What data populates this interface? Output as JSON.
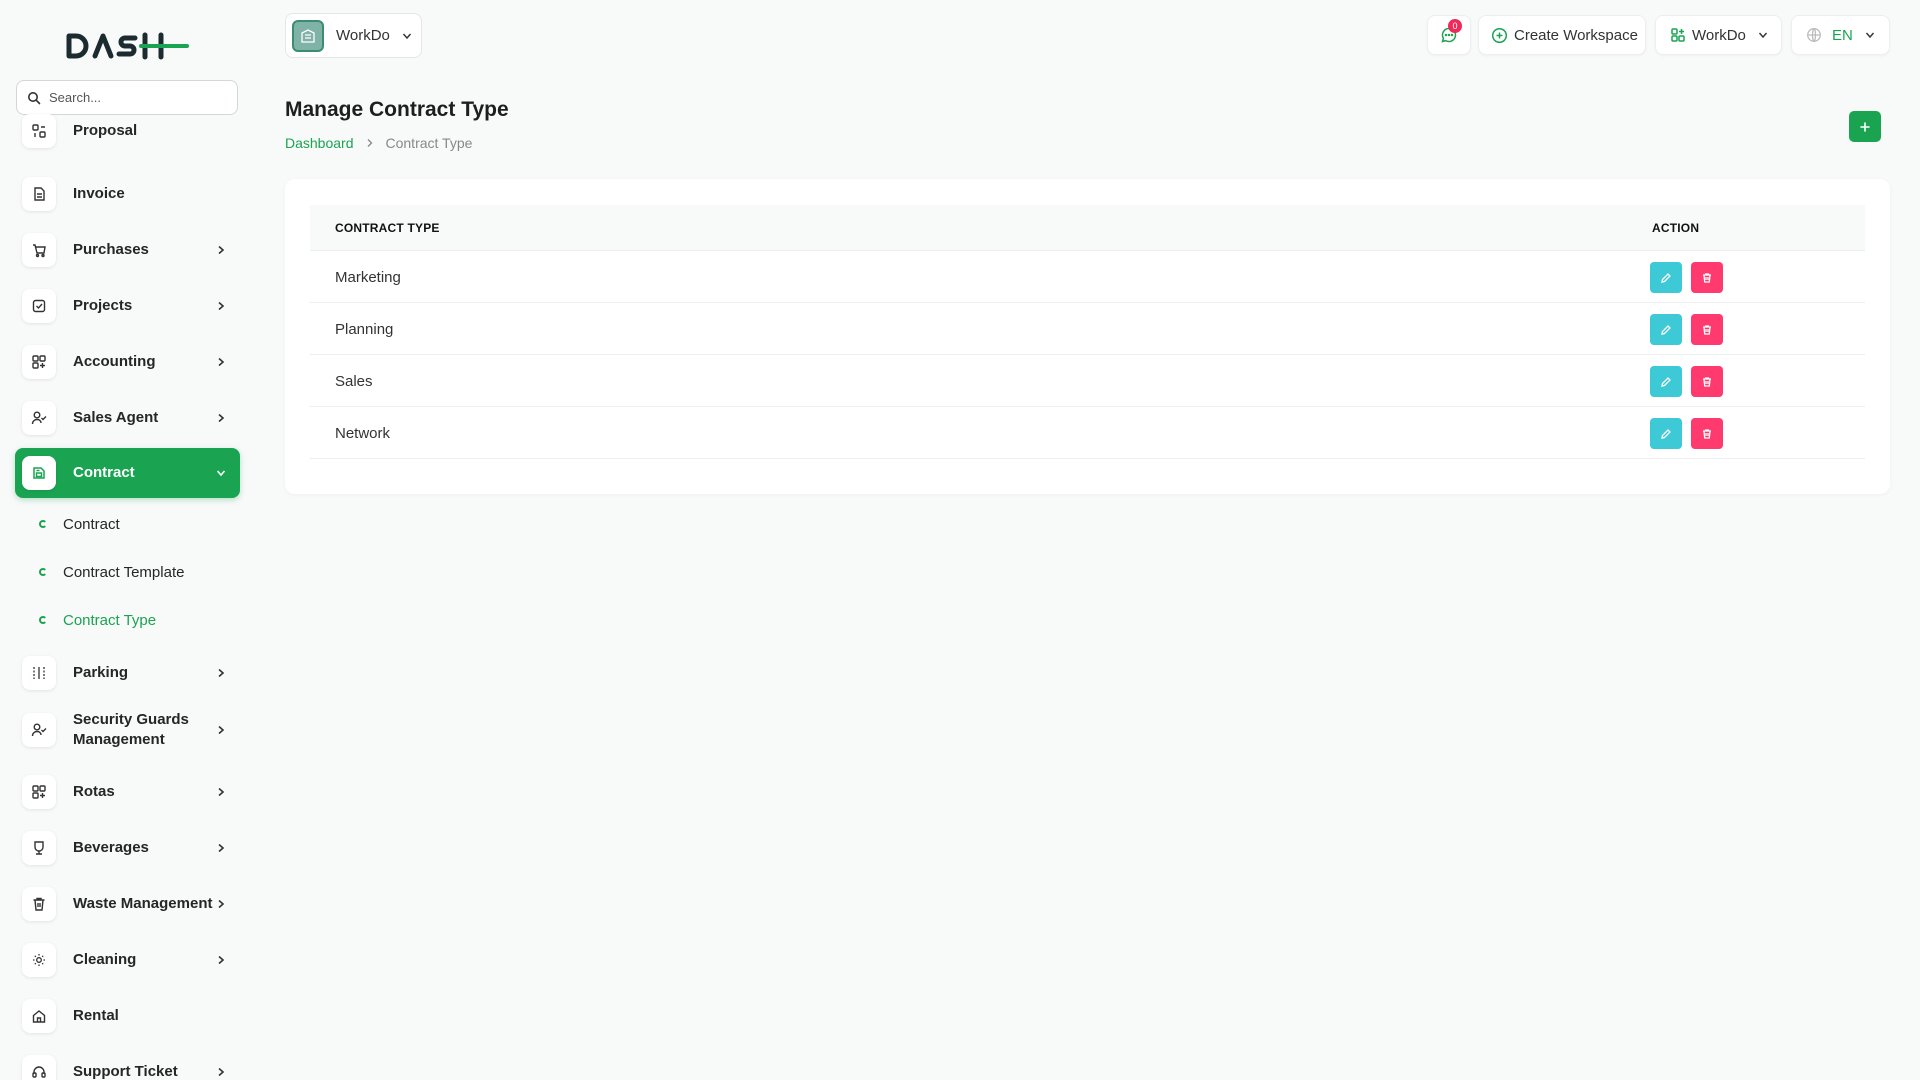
{
  "sidebar": {
    "search_placeholder": "Search...",
    "items": [
      {
        "label": "Proposal",
        "icon": "proposal-icon"
      },
      {
        "label": "Invoice",
        "icon": "invoice-icon"
      },
      {
        "label": "Purchases",
        "icon": "cart-icon"
      },
      {
        "label": "Projects",
        "icon": "checkbox-icon"
      },
      {
        "label": "Accounting",
        "icon": "grid-plus-icon"
      },
      {
        "label": "Sales Agent",
        "icon": "user-check-icon"
      },
      {
        "label": "Contract",
        "icon": "contract-icon"
      },
      {
        "label": "Parking",
        "icon": "parking-icon"
      },
      {
        "label": "Security Guards Management",
        "icon": "user-check-icon"
      },
      {
        "label": "Rotas",
        "icon": "grid-plus-icon"
      },
      {
        "label": "Beverages",
        "icon": "beverage-icon"
      },
      {
        "label": "Waste Management",
        "icon": "trash-icon"
      },
      {
        "label": "Cleaning",
        "icon": "sun-icon"
      },
      {
        "label": "Rental",
        "icon": "home-icon"
      },
      {
        "label": "Support Ticket",
        "icon": "headset-icon"
      }
    ],
    "sub_items": [
      {
        "label": "Contract"
      },
      {
        "label": "Contract Template"
      },
      {
        "label": "Contract Type"
      }
    ]
  },
  "header": {
    "workspace_name": "WorkDo",
    "notification_count": "0",
    "create_workspace_label": "Create Workspace",
    "workdo_label": "WorkDo",
    "language_label": "EN"
  },
  "page": {
    "title": "Manage Contract Type",
    "breadcrumb_home": "Dashboard",
    "breadcrumb_current": "Contract Type"
  },
  "table": {
    "columns": [
      "CONTRACT TYPE",
      "ACTION"
    ],
    "rows": [
      {
        "name": "Marketing"
      },
      {
        "name": "Planning"
      },
      {
        "name": "Sales"
      },
      {
        "name": "Network"
      }
    ]
  },
  "colors": {
    "brand_green": "#1aa452",
    "edit_cyan": "#3ec9d6",
    "delete_pink": "#ff3a6e"
  }
}
